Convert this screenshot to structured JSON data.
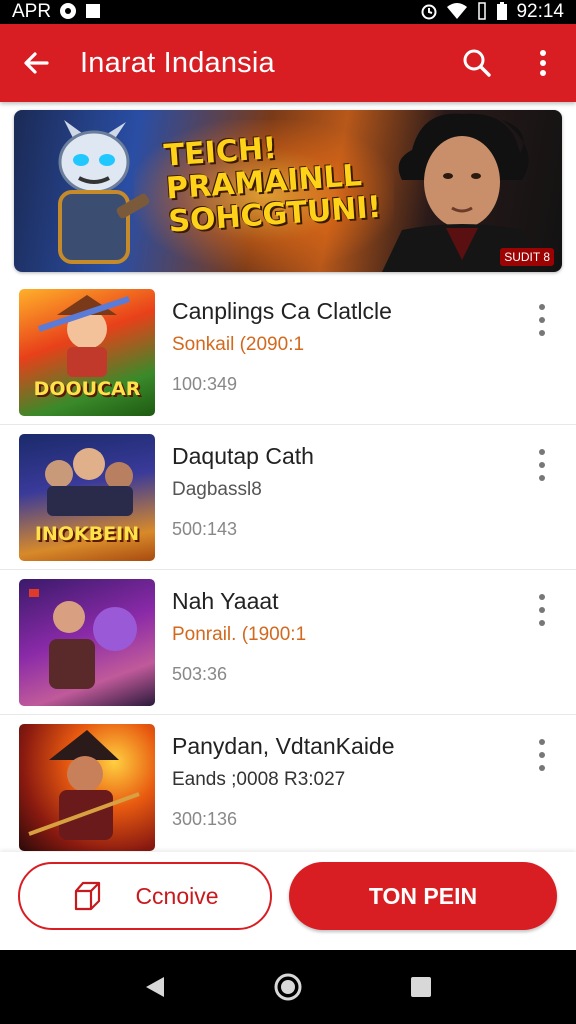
{
  "status_bar": {
    "left_text": "APR",
    "time": "92:14",
    "icons": [
      "at-icon",
      "notification-square-icon",
      "alarm-icon",
      "wifi-icon",
      "vibrate-icon",
      "battery-icon"
    ]
  },
  "app_bar": {
    "title": "Inarat Indansia",
    "back_icon": "arrow-left-icon",
    "actions": [
      "search-icon",
      "more-vert-icon"
    ],
    "color": "#d81e22"
  },
  "banner": {
    "headline": [
      "TEICH!",
      "PRAMAINLL",
      "SOHCGTUNI!"
    ],
    "badge": "SUDIT 8"
  },
  "items": [
    {
      "title": "Canplings Ca Clatlcle",
      "subtitle": "Sonkail (2090:1",
      "subtitle_color": "#d2691e",
      "meta": "100:349",
      "thumb_label": "DOOUCAR"
    },
    {
      "title": "Daqutap Cath",
      "subtitle": "Dagbassl8",
      "subtitle_color": "#555555",
      "meta": "500:143",
      "thumb_label": "INOKBEIN"
    },
    {
      "title": "Nah Yaaat",
      "subtitle": "Ponrail. (1900:1",
      "subtitle_color": "#d2691e",
      "meta": "503:36",
      "thumb_label": ""
    },
    {
      "title": "Panydan, VdtanKaide",
      "subtitle": "Eands ;0008 R3:027",
      "subtitle_color": "#333333",
      "meta": "300:136",
      "thumb_label": ""
    }
  ],
  "bottom_actions": {
    "secondary_label": "Ccnoive",
    "primary_label": "TON PEIN"
  },
  "nav": [
    "back-triangle-icon",
    "home-circle-icon",
    "recents-square-icon"
  ]
}
